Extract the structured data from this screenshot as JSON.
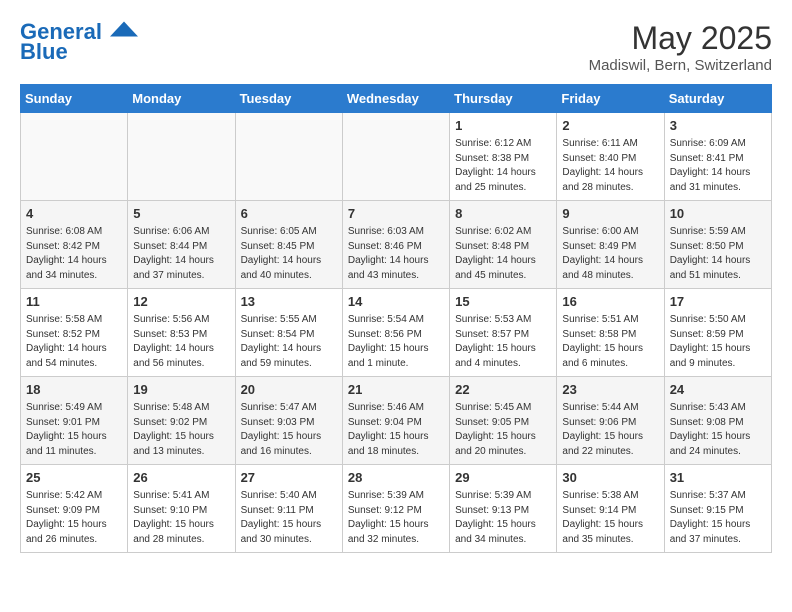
{
  "header": {
    "logo_line1": "General",
    "logo_line2": "Blue",
    "month": "May 2025",
    "location": "Madiswil, Bern, Switzerland"
  },
  "days_of_week": [
    "Sunday",
    "Monday",
    "Tuesday",
    "Wednesday",
    "Thursday",
    "Friday",
    "Saturday"
  ],
  "weeks": [
    [
      {
        "num": "",
        "info": ""
      },
      {
        "num": "",
        "info": ""
      },
      {
        "num": "",
        "info": ""
      },
      {
        "num": "",
        "info": ""
      },
      {
        "num": "1",
        "info": "Sunrise: 6:12 AM\nSunset: 8:38 PM\nDaylight: 14 hours and 25 minutes."
      },
      {
        "num": "2",
        "info": "Sunrise: 6:11 AM\nSunset: 8:40 PM\nDaylight: 14 hours and 28 minutes."
      },
      {
        "num": "3",
        "info": "Sunrise: 6:09 AM\nSunset: 8:41 PM\nDaylight: 14 hours and 31 minutes."
      }
    ],
    [
      {
        "num": "4",
        "info": "Sunrise: 6:08 AM\nSunset: 8:42 PM\nDaylight: 14 hours and 34 minutes."
      },
      {
        "num": "5",
        "info": "Sunrise: 6:06 AM\nSunset: 8:44 PM\nDaylight: 14 hours and 37 minutes."
      },
      {
        "num": "6",
        "info": "Sunrise: 6:05 AM\nSunset: 8:45 PM\nDaylight: 14 hours and 40 minutes."
      },
      {
        "num": "7",
        "info": "Sunrise: 6:03 AM\nSunset: 8:46 PM\nDaylight: 14 hours and 43 minutes."
      },
      {
        "num": "8",
        "info": "Sunrise: 6:02 AM\nSunset: 8:48 PM\nDaylight: 14 hours and 45 minutes."
      },
      {
        "num": "9",
        "info": "Sunrise: 6:00 AM\nSunset: 8:49 PM\nDaylight: 14 hours and 48 minutes."
      },
      {
        "num": "10",
        "info": "Sunrise: 5:59 AM\nSunset: 8:50 PM\nDaylight: 14 hours and 51 minutes."
      }
    ],
    [
      {
        "num": "11",
        "info": "Sunrise: 5:58 AM\nSunset: 8:52 PM\nDaylight: 14 hours and 54 minutes."
      },
      {
        "num": "12",
        "info": "Sunrise: 5:56 AM\nSunset: 8:53 PM\nDaylight: 14 hours and 56 minutes."
      },
      {
        "num": "13",
        "info": "Sunrise: 5:55 AM\nSunset: 8:54 PM\nDaylight: 14 hours and 59 minutes."
      },
      {
        "num": "14",
        "info": "Sunrise: 5:54 AM\nSunset: 8:56 PM\nDaylight: 15 hours and 1 minute."
      },
      {
        "num": "15",
        "info": "Sunrise: 5:53 AM\nSunset: 8:57 PM\nDaylight: 15 hours and 4 minutes."
      },
      {
        "num": "16",
        "info": "Sunrise: 5:51 AM\nSunset: 8:58 PM\nDaylight: 15 hours and 6 minutes."
      },
      {
        "num": "17",
        "info": "Sunrise: 5:50 AM\nSunset: 8:59 PM\nDaylight: 15 hours and 9 minutes."
      }
    ],
    [
      {
        "num": "18",
        "info": "Sunrise: 5:49 AM\nSunset: 9:01 PM\nDaylight: 15 hours and 11 minutes."
      },
      {
        "num": "19",
        "info": "Sunrise: 5:48 AM\nSunset: 9:02 PM\nDaylight: 15 hours and 13 minutes."
      },
      {
        "num": "20",
        "info": "Sunrise: 5:47 AM\nSunset: 9:03 PM\nDaylight: 15 hours and 16 minutes."
      },
      {
        "num": "21",
        "info": "Sunrise: 5:46 AM\nSunset: 9:04 PM\nDaylight: 15 hours and 18 minutes."
      },
      {
        "num": "22",
        "info": "Sunrise: 5:45 AM\nSunset: 9:05 PM\nDaylight: 15 hours and 20 minutes."
      },
      {
        "num": "23",
        "info": "Sunrise: 5:44 AM\nSunset: 9:06 PM\nDaylight: 15 hours and 22 minutes."
      },
      {
        "num": "24",
        "info": "Sunrise: 5:43 AM\nSunset: 9:08 PM\nDaylight: 15 hours and 24 minutes."
      }
    ],
    [
      {
        "num": "25",
        "info": "Sunrise: 5:42 AM\nSunset: 9:09 PM\nDaylight: 15 hours and 26 minutes."
      },
      {
        "num": "26",
        "info": "Sunrise: 5:41 AM\nSunset: 9:10 PM\nDaylight: 15 hours and 28 minutes."
      },
      {
        "num": "27",
        "info": "Sunrise: 5:40 AM\nSunset: 9:11 PM\nDaylight: 15 hours and 30 minutes."
      },
      {
        "num": "28",
        "info": "Sunrise: 5:39 AM\nSunset: 9:12 PM\nDaylight: 15 hours and 32 minutes."
      },
      {
        "num": "29",
        "info": "Sunrise: 5:39 AM\nSunset: 9:13 PM\nDaylight: 15 hours and 34 minutes."
      },
      {
        "num": "30",
        "info": "Sunrise: 5:38 AM\nSunset: 9:14 PM\nDaylight: 15 hours and 35 minutes."
      },
      {
        "num": "31",
        "info": "Sunrise: 5:37 AM\nSunset: 9:15 PM\nDaylight: 15 hours and 37 minutes."
      }
    ]
  ]
}
